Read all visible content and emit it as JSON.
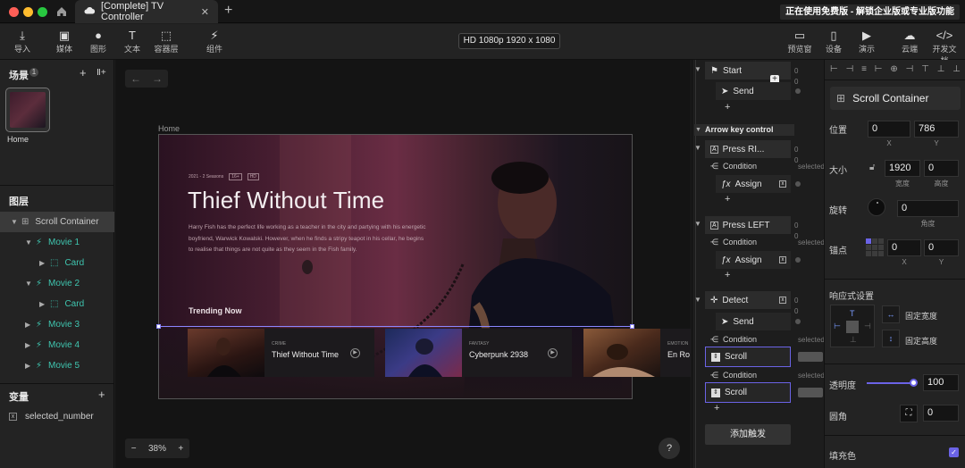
{
  "window": {
    "tab_title": "[Complete] TV Controller",
    "banner": "正在使用免费版 - 解锁企业版或专业版功能"
  },
  "toolbar": {
    "left": [
      {
        "label": "导入",
        "icon": "import-icon"
      },
      {
        "label": "媒体",
        "icon": "media-icon"
      },
      {
        "label": "图形",
        "icon": "shape-icon"
      },
      {
        "label": "文本",
        "icon": "text-icon"
      },
      {
        "label": "容器层",
        "icon": "container-icon"
      },
      {
        "label": "组件",
        "icon": "component-icon"
      }
    ],
    "resolution": "HD 1080p  1920 x 1080",
    "right": [
      {
        "label": "预览窗",
        "icon": "preview-icon"
      },
      {
        "label": "设备",
        "icon": "device-icon"
      },
      {
        "label": "演示",
        "icon": "play-icon"
      },
      {
        "label": "云端",
        "icon": "cloud-icon"
      },
      {
        "label": "开发文档",
        "icon": "code-icon"
      }
    ]
  },
  "scenes": {
    "title": "场景",
    "count": "1",
    "thumb_label": "Home"
  },
  "layers": {
    "title": "图层",
    "items": [
      "Scroll Container",
      "Movie 1",
      "Card",
      "Movie 2",
      "Card",
      "Movie 3",
      "Movie 4",
      "Movie 5"
    ]
  },
  "variables": {
    "title": "变量",
    "items": [
      "selected_number"
    ]
  },
  "canvas": {
    "frame_label": "Home",
    "meta": "2021 - 2 Seasons",
    "badges": [
      "16+",
      "HD"
    ],
    "title": "Thief Without Time",
    "desc": "Harry Fish has the perfect life working as a teacher in the city and partying with his energetic boyfriend, Warwick Kowalski. However, when he finds a stripy teapot in his cellar, he begins to realise that things are not quite as they seem in the Fish family.",
    "trending": "Trending Now",
    "cards": [
      {
        "genre": "CRIME",
        "title": "Thief Without Time"
      },
      {
        "genre": "FANTASY",
        "title": "Cyberpunk 2938"
      },
      {
        "genre": "EMOTION",
        "title": "En Ro"
      }
    ],
    "zoom": "38%",
    "help": "?"
  },
  "flow": {
    "start": "Start",
    "send": "Send",
    "section": "Arrow key control",
    "press_right": "Press RI...",
    "press_left": "Press LEFT",
    "condition": "Condition",
    "assign": "Assign",
    "detect": "Detect",
    "scroll": "Scroll",
    "add_trigger": "添加触发",
    "selected": "selected",
    "zero": "0"
  },
  "props": {
    "title": "Scroll Container",
    "position": {
      "label": "位置",
      "x": "0",
      "y": "786",
      "x_cap": "X",
      "y_cap": "Y"
    },
    "size": {
      "label": "大小",
      "w": "1920",
      "h": "0",
      "w_cap": "宽度",
      "h_cap": "高度"
    },
    "rotation": {
      "label": "旋转",
      "value": "0",
      "cap": "角度"
    },
    "anchor": {
      "label": "锚点",
      "x": "0",
      "y": "0",
      "x_cap": "X",
      "y_cap": "Y"
    },
    "responsive": {
      "label": "响应式设置",
      "fixed_w": "固定宽度",
      "fixed_h": "固定高度"
    },
    "opacity": {
      "label": "透明度",
      "value": "100"
    },
    "radius": {
      "label": "圆角",
      "value": "0"
    },
    "fill": {
      "label": "填充色"
    }
  },
  "colors": {
    "accent": "#6b63e6",
    "teal": "#3fc6b0"
  }
}
